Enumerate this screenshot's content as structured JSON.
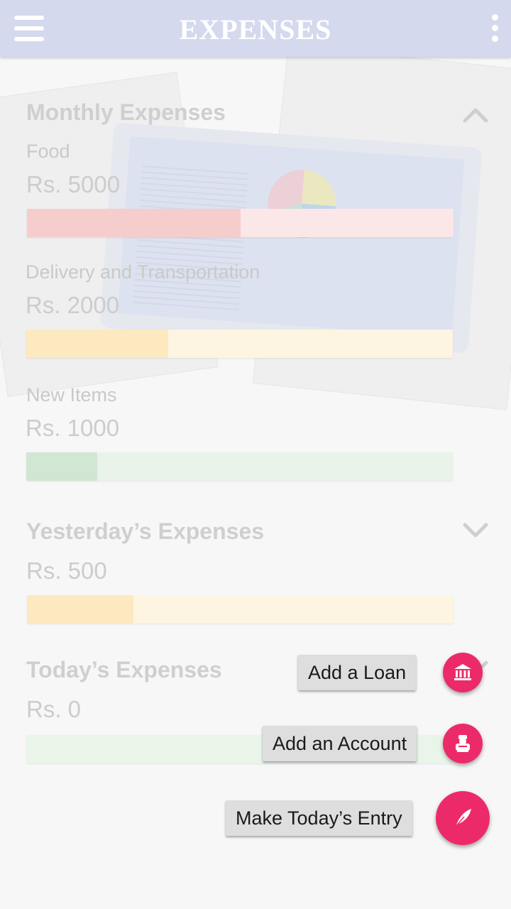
{
  "app_bar": {
    "title": "EXPENSES",
    "menu_icon": "hamburger-menu-icon",
    "overflow_icon": "more-vertical-icon"
  },
  "monthly": {
    "title": "Monthly Expenses",
    "expanded": true,
    "items": [
      {
        "label": "Food",
        "amount": "Rs. 5000",
        "progress": 0.5,
        "track_color": "#fbe7e7",
        "fill_color": "#f6cdcd"
      },
      {
        "label": "Delivery and Transportation",
        "amount": "Rs. 2000",
        "progress": 0.333,
        "track_color": "#fdf5e2",
        "fill_color": "#fde9c0"
      },
      {
        "label": "New Items",
        "amount": "Rs. 1000",
        "progress": 0.167,
        "track_color": "#eaf3e9",
        "fill_color": "#d1e6d3"
      }
    ]
  },
  "yesterday": {
    "title": "Yesterday’s Expenses",
    "expanded": false,
    "amount": "Rs. 500",
    "progress": 0.25,
    "track_color": "#fdf5e2",
    "fill_color": "#fde9c0"
  },
  "today": {
    "title": "Today’s Expenses",
    "amount": "Rs. 0",
    "progress": 0,
    "track_color": "#eaf5ea"
  },
  "fab_menu": {
    "add_loan": {
      "label": "Add a Loan",
      "icon": "bank-icon"
    },
    "add_account": {
      "label": "Add an Account",
      "icon": "account-icon"
    },
    "make_entry": {
      "label": "Make Today’s Entry",
      "icon": "feather-quill-icon"
    },
    "accent_color": "#ec2a6a"
  }
}
